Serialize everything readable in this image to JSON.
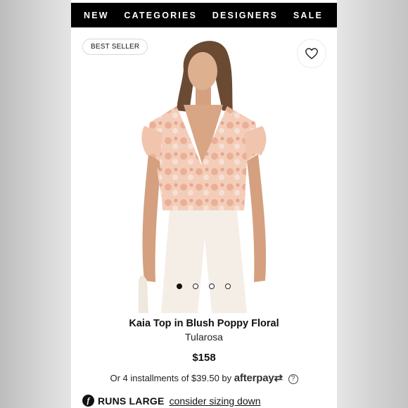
{
  "nav": {
    "items": [
      {
        "label": "NEW"
      },
      {
        "label": "CATEGORIES"
      },
      {
        "label": "DESIGNERS"
      },
      {
        "label": "SALE"
      }
    ]
  },
  "product": {
    "badge": "BEST SELLER",
    "title": "Kaia Top in Blush Poppy Floral",
    "brand": "Tularosa",
    "price": "$158",
    "image_count": 4,
    "active_image": 1
  },
  "payment": {
    "installments_text": "Or 4 installments of $39.50 by",
    "provider": "afterpay",
    "help_glyph": "?"
  },
  "fit": {
    "label": "RUNS LARGE",
    "link": "consider sizing down"
  },
  "icons": {
    "wishlist": "heart-outline-icon",
    "fit": "fit-predictor-icon",
    "help": "question-circle-icon"
  }
}
